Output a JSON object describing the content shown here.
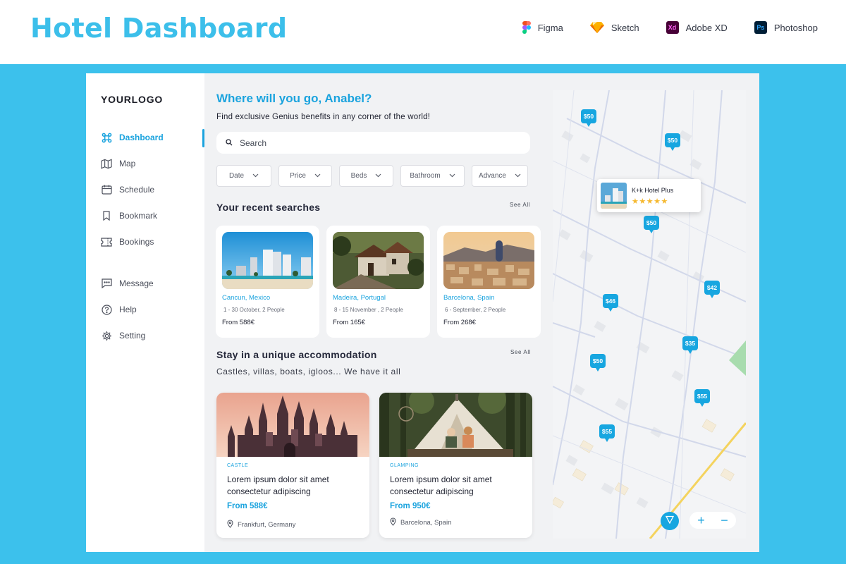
{
  "banner": {
    "title": "Hotel Dashboard",
    "tools": [
      {
        "label": "Figma",
        "icon": "figma-icon"
      },
      {
        "label": "Sketch",
        "icon": "sketch-icon"
      },
      {
        "label": "Adobe XD",
        "icon": "adobe-xd-icon",
        "abbr": "Xd"
      },
      {
        "label": "Photoshop",
        "icon": "photoshop-icon",
        "abbr": "Ps"
      }
    ]
  },
  "colors": {
    "accent": "#1aa3de",
    "stage": "#3cc1ec",
    "star": "#f5b82e"
  },
  "sidebar": {
    "logo": "YOURLOGO",
    "items": [
      {
        "label": "Dashboard",
        "icon": "command-icon",
        "active": true
      },
      {
        "label": "Map",
        "icon": "map-icon"
      },
      {
        "label": "Schedule",
        "icon": "calendar-icon"
      },
      {
        "label": "Bookmark",
        "icon": "bookmark-icon"
      },
      {
        "label": "Bookings",
        "icon": "ticket-icon"
      },
      {
        "label": "Message",
        "icon": "message-icon"
      },
      {
        "label": "Help",
        "icon": "help-icon"
      },
      {
        "label": "Setting",
        "icon": "gear-icon"
      }
    ]
  },
  "main": {
    "greeting": "Where will you go, Anabel?",
    "subtitle": "Find exclusive Genius benefits in any corner of the world!",
    "search": {
      "placeholder": "Search"
    },
    "filters": [
      "Date",
      "Price",
      "Beds",
      "Bathroom",
      "Advance"
    ],
    "recent": {
      "title": "Your recent searches",
      "see_all": "See All",
      "cards": [
        {
          "location": "Cancun, Mexico",
          "dates": "1 - 30 October, 2 People",
          "price": "From 588€"
        },
        {
          "location": "Madeira, Portugal",
          "dates": "8 - 15 November , 2 People",
          "price": "From 165€"
        },
        {
          "location": "Barcelona, Spain",
          "dates": "6 - September, 2 People",
          "price": "From 268€"
        }
      ]
    },
    "accommodation": {
      "title": "Stay in a unique accommodation",
      "see_all": "See All",
      "description": "Castles, villas, boats, igloos... We have it all",
      "cards": [
        {
          "category": "CASTLE",
          "title": "Lorem ipsum dolor sit amet consectetur adipiscing",
          "price": "From 588€",
          "location": "Frankfurt, Germany"
        },
        {
          "category": "GLAMPING",
          "title": "Lorem ipsum dolor sit amet consectetur adipiscing",
          "price": "From 950€",
          "location": "Barcelona, Spain"
        }
      ]
    }
  },
  "map": {
    "pins": [
      "$50",
      "$50",
      "$50",
      "$42",
      "$46",
      "$35",
      "$50",
      "$55",
      "$55"
    ],
    "popup": {
      "name": "K+k Hotel Plus",
      "stars": "★★★★★",
      "rating": 5
    },
    "zoom_in": "+",
    "zoom_out": "−"
  }
}
